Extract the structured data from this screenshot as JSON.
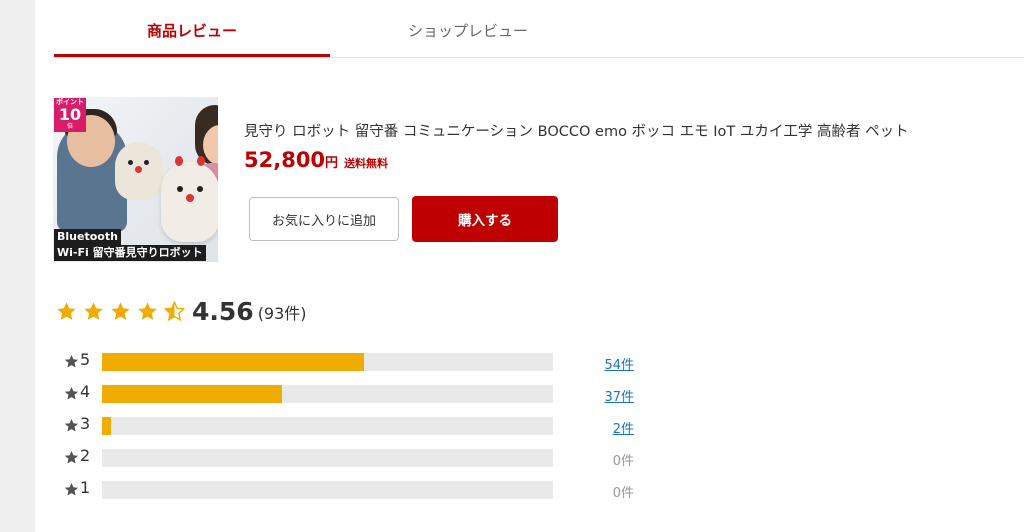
{
  "tabs": [
    {
      "label": "商品レビュー",
      "active": true
    },
    {
      "label": "ショップレビュー",
      "active": false
    }
  ],
  "product": {
    "title": "見守り ロボット 留守番 コミュニケーション BOCCO emo ボッコ エモ IoT ユカイ工学 高齢者 ペット",
    "price": "52,800",
    "price_unit": "円",
    "shipping": "送料無料",
    "image": {
      "badge_top": "ポイント",
      "badge_num": "10",
      "badge_unit": "倍",
      "label1": "Bluetooth",
      "label2": "Wi-Fi 留守番見守りロボット"
    }
  },
  "buttons": {
    "favorite": "お気に入りに追加",
    "buy": "購入する"
  },
  "rating": {
    "average": "4.56",
    "count": "(93件)",
    "stars_value": 4.56,
    "distribution": [
      {
        "stars": "5",
        "count_label": "54件",
        "fraction": 0.58,
        "linked": true
      },
      {
        "stars": "4",
        "count_label": "37件",
        "fraction": 0.4,
        "linked": true
      },
      {
        "stars": "3",
        "count_label": "2件",
        "fraction": 0.02,
        "linked": true
      },
      {
        "stars": "2",
        "count_label": "0件",
        "fraction": 0.0,
        "linked": false
      },
      {
        "stars": "1",
        "count_label": "0件",
        "fraction": 0.0,
        "linked": false
      }
    ]
  },
  "colors": {
    "accent": "#bf0000",
    "star": "#f0ac00",
    "link": "#1a73c0"
  }
}
